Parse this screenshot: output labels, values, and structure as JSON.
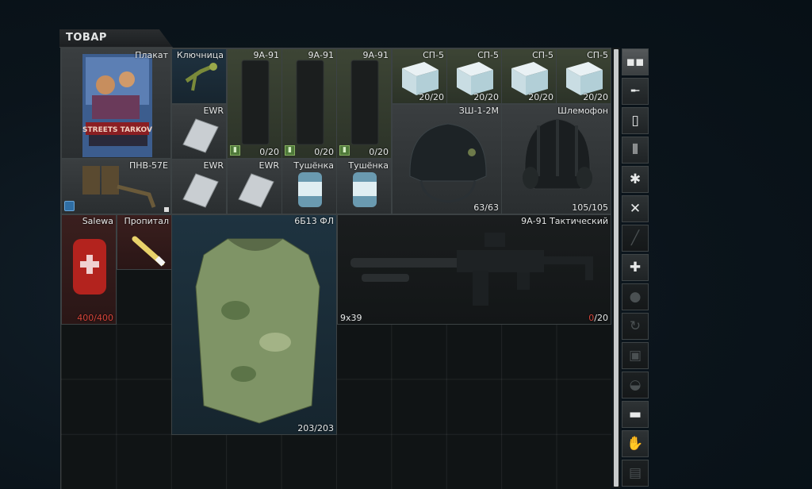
{
  "header": {
    "title": "ТОВАР"
  },
  "items": {
    "poster": {
      "name": "Плакат",
      "art_text": "STREETS TARKOV"
    },
    "keytool": {
      "name": "Ключница"
    },
    "mag1": {
      "name": "9А-91",
      "count": "0/20"
    },
    "mag2": {
      "name": "9А-91",
      "count": "0/20"
    },
    "mag3": {
      "name": "9А-91",
      "count": "0/20"
    },
    "sp5_1": {
      "name": "СП-5",
      "count": "20/20"
    },
    "sp5_2": {
      "name": "СП-5",
      "count": "20/20"
    },
    "sp5_3": {
      "name": "СП-5",
      "count": "20/20"
    },
    "sp5_4": {
      "name": "СП-5",
      "count": "20/20"
    },
    "ewr1": {
      "name": "EWR"
    },
    "helmet": {
      "name": "ЗШ-1-2М",
      "count": "63/63"
    },
    "shlemofon": {
      "name": "Шлемофон",
      "count": "105/105"
    },
    "nvg": {
      "name": "ПНВ-57Е"
    },
    "ewr2": {
      "name": "EWR"
    },
    "ewr3": {
      "name": "EWR"
    },
    "can1": {
      "name": "Тушёнка"
    },
    "can2": {
      "name": "Тушёнка"
    },
    "salewa": {
      "name": "Salewa",
      "count": "400/400"
    },
    "propital": {
      "name": "Пропитал"
    },
    "armor": {
      "name": "6Б13 ФЛ",
      "count": "203/203"
    },
    "rifle": {
      "name": "9А-91 Тактический",
      "caliber": "9x39",
      "ammo_loaded": "0",
      "ammo_capacity": "/20"
    }
  },
  "sidebar": {
    "buttons": [
      "grid-icon",
      "rifle-icon",
      "magazine-icon",
      "ammo-icon",
      "star-icon",
      "food-icon",
      "knife-icon",
      "medical-icon",
      "grenade-icon",
      "barter-icon",
      "armor-icon",
      "backpack-icon",
      "case-icon",
      "gloves-icon",
      "map-icon"
    ]
  },
  "colors": {
    "accent_red": "#d6453a",
    "badge_green": "#4f7a3a",
    "badge_blue": "#2f6ea4"
  }
}
